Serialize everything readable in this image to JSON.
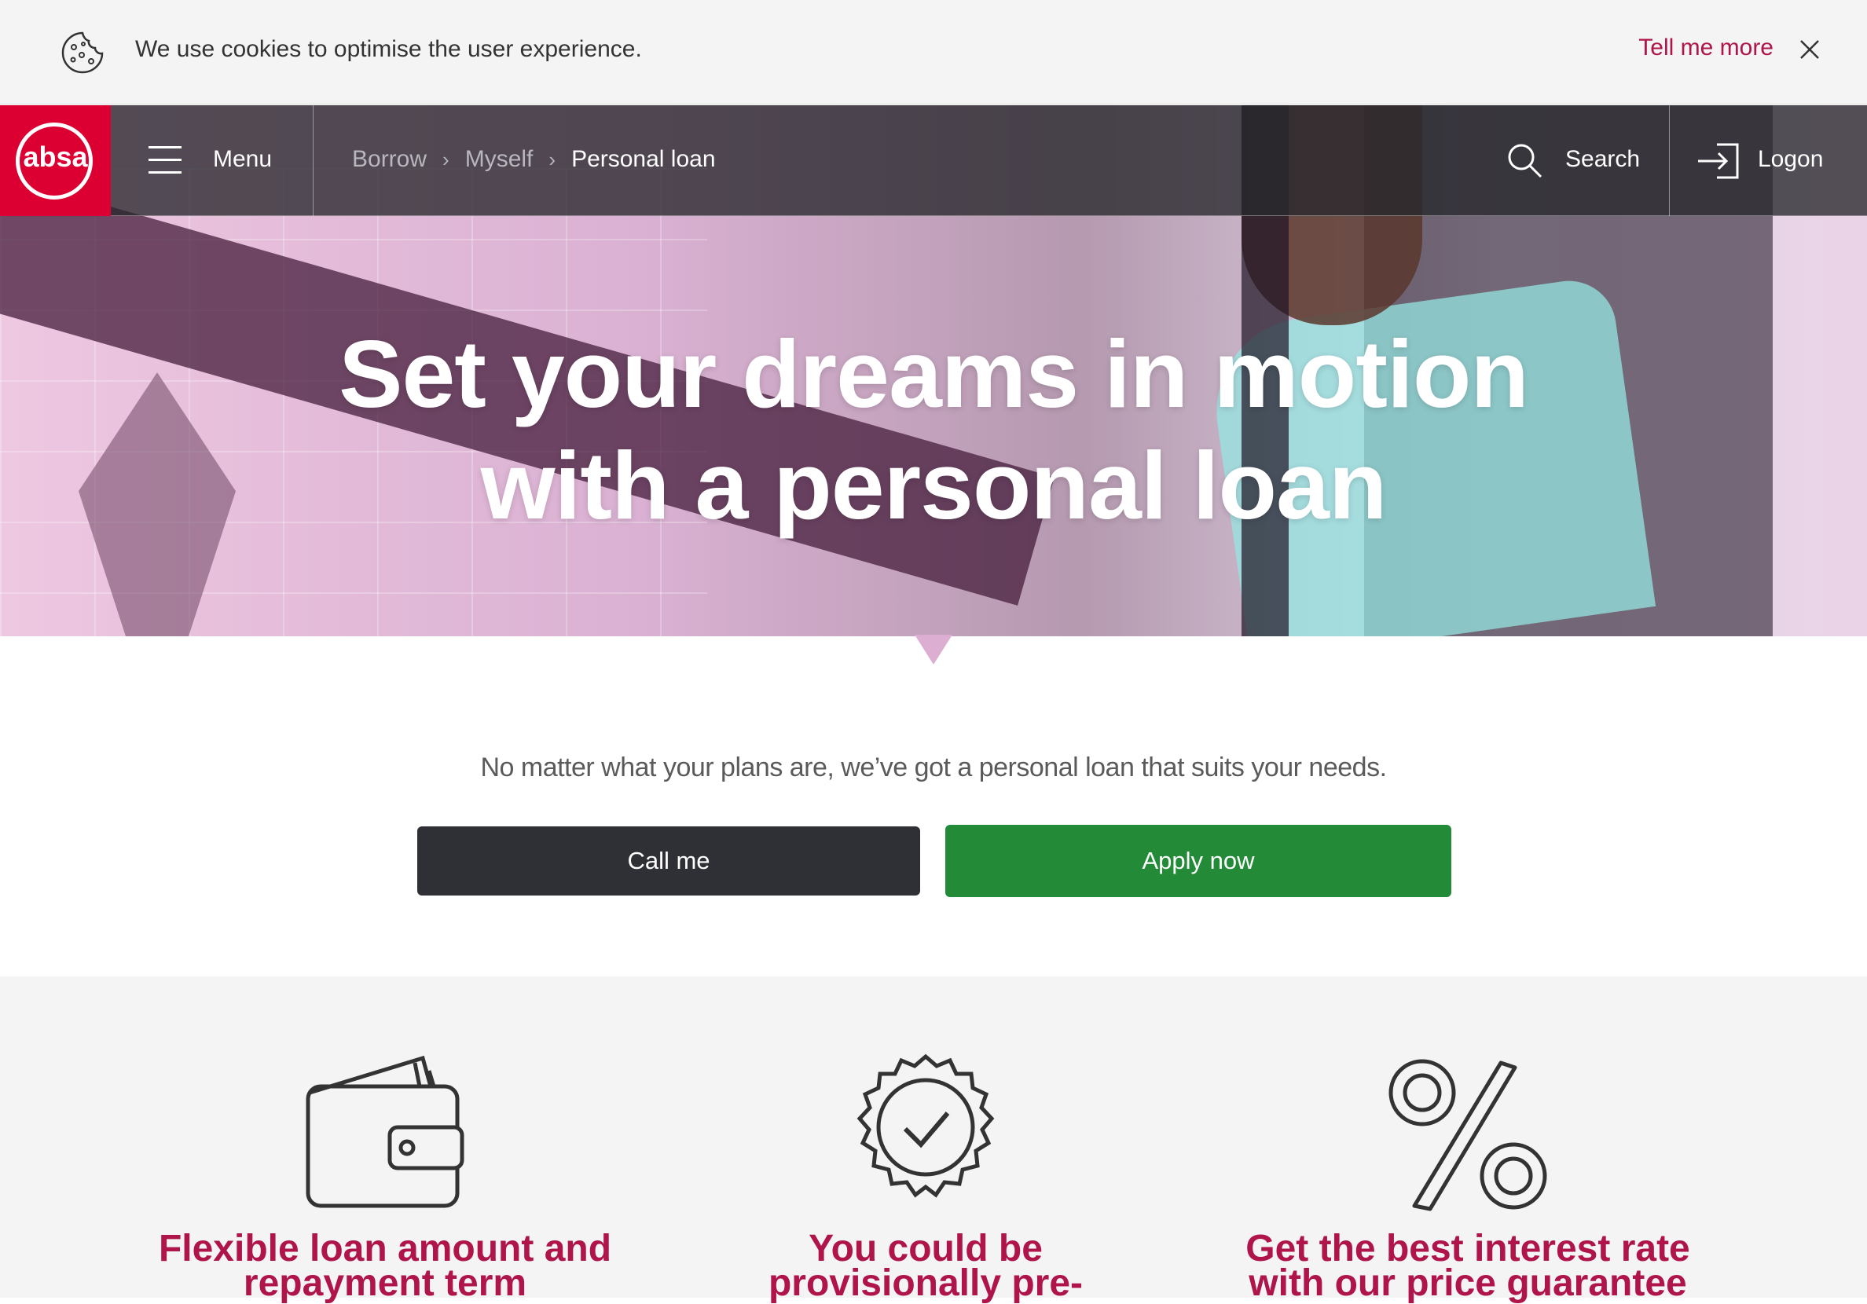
{
  "cookie_banner": {
    "message": "We use cookies to optimise the user experience.",
    "link_label": "Tell me more",
    "icon": "cookie-icon"
  },
  "nav": {
    "logo_text": "absa",
    "menu_label": "Menu",
    "breadcrumb": [
      "Borrow",
      "Myself",
      "Personal loan"
    ],
    "search_label": "Search",
    "logon_label": "Logon"
  },
  "hero": {
    "title_line1": "Set your dreams in motion",
    "title_line2": "with a personal loan"
  },
  "intro": {
    "text": "No matter what your plans are, we’ve got a personal loan that suits your needs.",
    "call_label": "Call me",
    "apply_label": "Apply now"
  },
  "features": [
    {
      "icon": "wallet-icon",
      "title_line1": "Flexible loan amount and",
      "title_line2": "repayment term"
    },
    {
      "icon": "verified-badge-icon",
      "title_line1": "You could be",
      "title_line2": "provisionally pre-"
    },
    {
      "icon": "percent-icon",
      "title_line1": "Get the best interest rate",
      "title_line2": "with our price guarantee"
    }
  ],
  "colors": {
    "brand_red": "#dc0032",
    "accent_text": "#af144b",
    "apply_green": "#238b37",
    "call_dark": "#2e3036"
  }
}
